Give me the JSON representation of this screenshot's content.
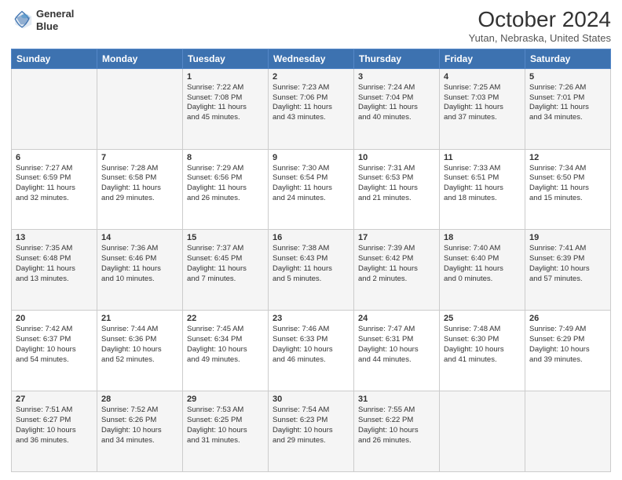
{
  "logo": {
    "line1": "General",
    "line2": "Blue"
  },
  "title": "October 2024",
  "subtitle": "Yutan, Nebraska, United States",
  "days_of_week": [
    "Sunday",
    "Monday",
    "Tuesday",
    "Wednesday",
    "Thursday",
    "Friday",
    "Saturday"
  ],
  "weeks": [
    [
      {
        "day": "",
        "info": ""
      },
      {
        "day": "",
        "info": ""
      },
      {
        "day": "1",
        "info": "Sunrise: 7:22 AM\nSunset: 7:08 PM\nDaylight: 11 hours\nand 45 minutes."
      },
      {
        "day": "2",
        "info": "Sunrise: 7:23 AM\nSunset: 7:06 PM\nDaylight: 11 hours\nand 43 minutes."
      },
      {
        "day": "3",
        "info": "Sunrise: 7:24 AM\nSunset: 7:04 PM\nDaylight: 11 hours\nand 40 minutes."
      },
      {
        "day": "4",
        "info": "Sunrise: 7:25 AM\nSunset: 7:03 PM\nDaylight: 11 hours\nand 37 minutes."
      },
      {
        "day": "5",
        "info": "Sunrise: 7:26 AM\nSunset: 7:01 PM\nDaylight: 11 hours\nand 34 minutes."
      }
    ],
    [
      {
        "day": "6",
        "info": "Sunrise: 7:27 AM\nSunset: 6:59 PM\nDaylight: 11 hours\nand 32 minutes."
      },
      {
        "day": "7",
        "info": "Sunrise: 7:28 AM\nSunset: 6:58 PM\nDaylight: 11 hours\nand 29 minutes."
      },
      {
        "day": "8",
        "info": "Sunrise: 7:29 AM\nSunset: 6:56 PM\nDaylight: 11 hours\nand 26 minutes."
      },
      {
        "day": "9",
        "info": "Sunrise: 7:30 AM\nSunset: 6:54 PM\nDaylight: 11 hours\nand 24 minutes."
      },
      {
        "day": "10",
        "info": "Sunrise: 7:31 AM\nSunset: 6:53 PM\nDaylight: 11 hours\nand 21 minutes."
      },
      {
        "day": "11",
        "info": "Sunrise: 7:33 AM\nSunset: 6:51 PM\nDaylight: 11 hours\nand 18 minutes."
      },
      {
        "day": "12",
        "info": "Sunrise: 7:34 AM\nSunset: 6:50 PM\nDaylight: 11 hours\nand 15 minutes."
      }
    ],
    [
      {
        "day": "13",
        "info": "Sunrise: 7:35 AM\nSunset: 6:48 PM\nDaylight: 11 hours\nand 13 minutes."
      },
      {
        "day": "14",
        "info": "Sunrise: 7:36 AM\nSunset: 6:46 PM\nDaylight: 11 hours\nand 10 minutes."
      },
      {
        "day": "15",
        "info": "Sunrise: 7:37 AM\nSunset: 6:45 PM\nDaylight: 11 hours\nand 7 minutes."
      },
      {
        "day": "16",
        "info": "Sunrise: 7:38 AM\nSunset: 6:43 PM\nDaylight: 11 hours\nand 5 minutes."
      },
      {
        "day": "17",
        "info": "Sunrise: 7:39 AM\nSunset: 6:42 PM\nDaylight: 11 hours\nand 2 minutes."
      },
      {
        "day": "18",
        "info": "Sunrise: 7:40 AM\nSunset: 6:40 PM\nDaylight: 11 hours\nand 0 minutes."
      },
      {
        "day": "19",
        "info": "Sunrise: 7:41 AM\nSunset: 6:39 PM\nDaylight: 10 hours\nand 57 minutes."
      }
    ],
    [
      {
        "day": "20",
        "info": "Sunrise: 7:42 AM\nSunset: 6:37 PM\nDaylight: 10 hours\nand 54 minutes."
      },
      {
        "day": "21",
        "info": "Sunrise: 7:44 AM\nSunset: 6:36 PM\nDaylight: 10 hours\nand 52 minutes."
      },
      {
        "day": "22",
        "info": "Sunrise: 7:45 AM\nSunset: 6:34 PM\nDaylight: 10 hours\nand 49 minutes."
      },
      {
        "day": "23",
        "info": "Sunrise: 7:46 AM\nSunset: 6:33 PM\nDaylight: 10 hours\nand 46 minutes."
      },
      {
        "day": "24",
        "info": "Sunrise: 7:47 AM\nSunset: 6:31 PM\nDaylight: 10 hours\nand 44 minutes."
      },
      {
        "day": "25",
        "info": "Sunrise: 7:48 AM\nSunset: 6:30 PM\nDaylight: 10 hours\nand 41 minutes."
      },
      {
        "day": "26",
        "info": "Sunrise: 7:49 AM\nSunset: 6:29 PM\nDaylight: 10 hours\nand 39 minutes."
      }
    ],
    [
      {
        "day": "27",
        "info": "Sunrise: 7:51 AM\nSunset: 6:27 PM\nDaylight: 10 hours\nand 36 minutes."
      },
      {
        "day": "28",
        "info": "Sunrise: 7:52 AM\nSunset: 6:26 PM\nDaylight: 10 hours\nand 34 minutes."
      },
      {
        "day": "29",
        "info": "Sunrise: 7:53 AM\nSunset: 6:25 PM\nDaylight: 10 hours\nand 31 minutes."
      },
      {
        "day": "30",
        "info": "Sunrise: 7:54 AM\nSunset: 6:23 PM\nDaylight: 10 hours\nand 29 minutes."
      },
      {
        "day": "31",
        "info": "Sunrise: 7:55 AM\nSunset: 6:22 PM\nDaylight: 10 hours\nand 26 minutes."
      },
      {
        "day": "",
        "info": ""
      },
      {
        "day": "",
        "info": ""
      }
    ]
  ]
}
